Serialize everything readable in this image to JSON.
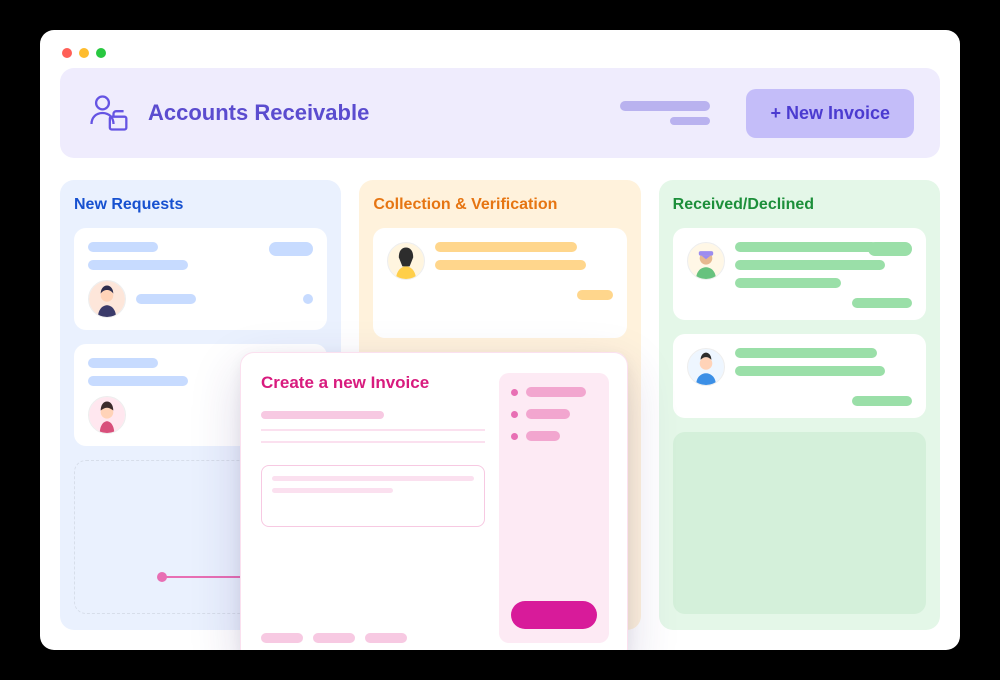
{
  "header": {
    "title": "Accounts Receivable",
    "new_invoice_label": "+ New Invoice"
  },
  "columns": {
    "new_requests": {
      "title": "New Requests"
    },
    "collection_verification": {
      "title": "Collection & Verification"
    },
    "received_declined": {
      "title": "Received/Declined"
    }
  },
  "modal": {
    "title": "Create a new Invoice"
  },
  "colors": {
    "primary": "#5b4ccf",
    "blue": "#1751d0",
    "orange": "#e67512",
    "green": "#1c8f3a",
    "pink": "#d81b7e"
  }
}
